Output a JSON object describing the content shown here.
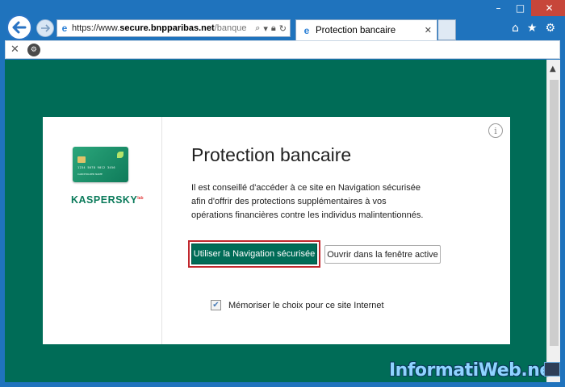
{
  "browser": {
    "url_scheme": "https://www.",
    "url_host": "secure.bnpparibas.net",
    "url_path": "/banque",
    "tab_title": "Protection bancaire",
    "window_controls": {
      "minimize": "–",
      "maximize": "□",
      "close": "✕"
    },
    "icons": [
      "back-arrow-icon",
      "forward-arrow-icon",
      "ie-logo-icon",
      "search-icon",
      "lock-icon",
      "refresh-icon",
      "home-icon",
      "star-icon",
      "gear-icon"
    ]
  },
  "command_bar": {
    "close_glyph": "✕",
    "kaspersky_glyph": "⚙"
  },
  "dialog": {
    "brand": "KASPERSKY",
    "brand_sup": "lab",
    "card_number": "1234 5678 9012 3456",
    "card_holder": "CARDHOLDER NAME",
    "title": "Protection bancaire",
    "description": "Il est conseillé d'accéder à ce site en Navigation sécurisée afin d'offrir des protections supplémentaires à vos opérations financières contre les individus malintentionnés.",
    "primary_button": "Utiliser la Navigation sécurisée",
    "secondary_button": "Ouvrir dans la fenêtre active",
    "remember_label": "Mémoriser le choix pour ce site Internet",
    "remember_checked": true,
    "info_glyph": "i"
  },
  "watermark": "InformatiWeb.net",
  "colors": {
    "page_background": "#006c57",
    "primary_button": "#006c57",
    "highlight_border": "#c1272d",
    "browser_chrome": "#1f73bd"
  }
}
